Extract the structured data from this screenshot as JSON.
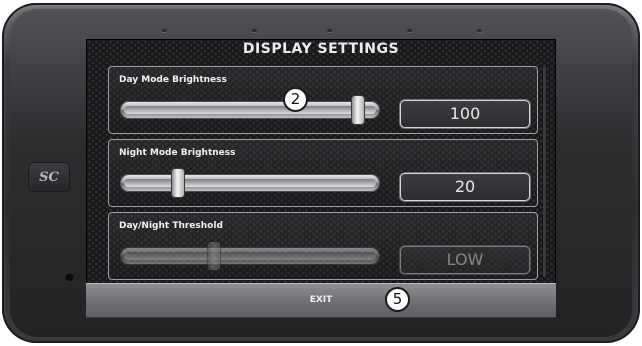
{
  "device": {
    "logo_text": "SC"
  },
  "screen": {
    "title": "DISPLAY SETTINGS"
  },
  "settings": [
    {
      "label": "Day Mode Brightness",
      "value": "100",
      "level": 0.95
    },
    {
      "label": "Night Mode Brightness",
      "value": "20",
      "level": 0.2
    },
    {
      "label": "Day/Night Threshold",
      "value": "LOW",
      "level": 0.35
    }
  ],
  "callouts": {
    "slider_marker": "2",
    "exit_marker": "5"
  },
  "exit": {
    "label": "EXIT"
  },
  "colors": {
    "screen_bg": "#161718",
    "bezel": "#2a2b2d",
    "text": "#f2f2f2"
  }
}
